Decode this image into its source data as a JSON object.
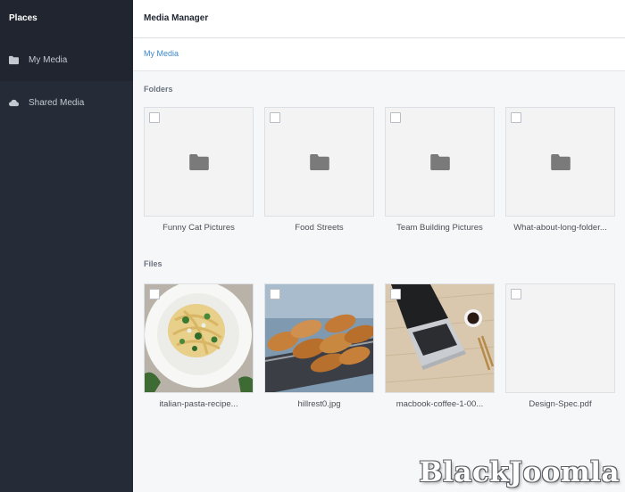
{
  "sidebar": {
    "title": "Places",
    "items": [
      {
        "label": "My Media",
        "icon": "folder-icon"
      },
      {
        "label": "Shared Media",
        "icon": "cloud-icon"
      }
    ]
  },
  "header": {
    "title": "Media Manager"
  },
  "breadcrumb": {
    "label": "My Media"
  },
  "folders": {
    "label": "Folders",
    "items": [
      "Funny Cat Pictures",
      "Food Streets",
      "Team Building Pictures",
      "What-about-long-folder..."
    ]
  },
  "files": {
    "label": "Files",
    "items": [
      "italian-pasta-recipe...",
      "hillrest0.jpg",
      "macbook-coffee-1-00...",
      "Design-Spec.pdf"
    ]
  },
  "watermark": "BlackJoomla",
  "colors": {
    "sidebar": "#262c37",
    "link": "#3d87c9",
    "background": "#f6f7f8"
  }
}
